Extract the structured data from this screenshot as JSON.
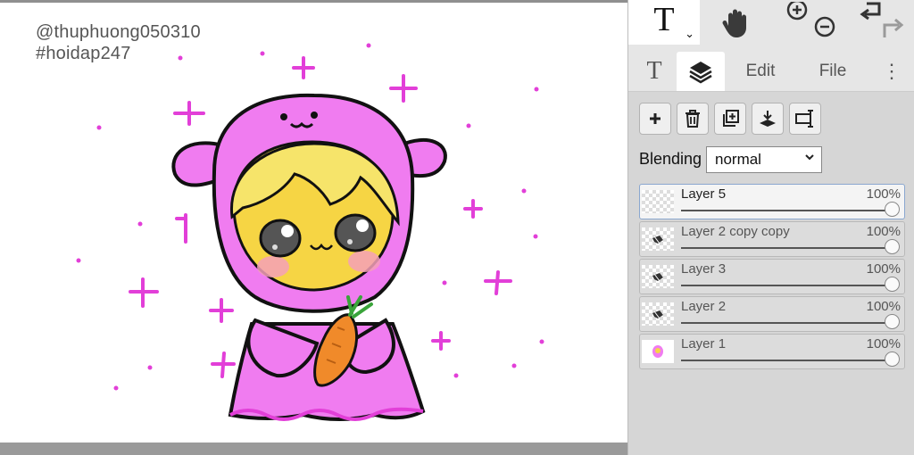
{
  "canvas": {
    "watermark_line1": "@thuphuong050310",
    "watermark_line2": "#hoidap247"
  },
  "toolbar": {
    "text_tool": "T",
    "text_tool_chevron": "⌄"
  },
  "tabs": {
    "text": "T",
    "edit": "Edit",
    "file": "File",
    "more": "⋮"
  },
  "blending": {
    "label": "Blending",
    "value": "normal"
  },
  "layers": [
    {
      "name": "Layer 5",
      "opacity": "100%"
    },
    {
      "name": "Layer 2 copy copy",
      "opacity": "100%"
    },
    {
      "name": "Layer 3",
      "opacity": "100%"
    },
    {
      "name": "Layer 2",
      "opacity": "100%"
    },
    {
      "name": "Layer 1",
      "opacity": "100%"
    }
  ],
  "colors": {
    "accent_pink": "#e23fd8",
    "hood_pink": "#f07cf0",
    "hair_yellow": "#f6e46a",
    "carrot_orange": "#f08a2a",
    "active_layer_border": "#8aa7cf"
  }
}
